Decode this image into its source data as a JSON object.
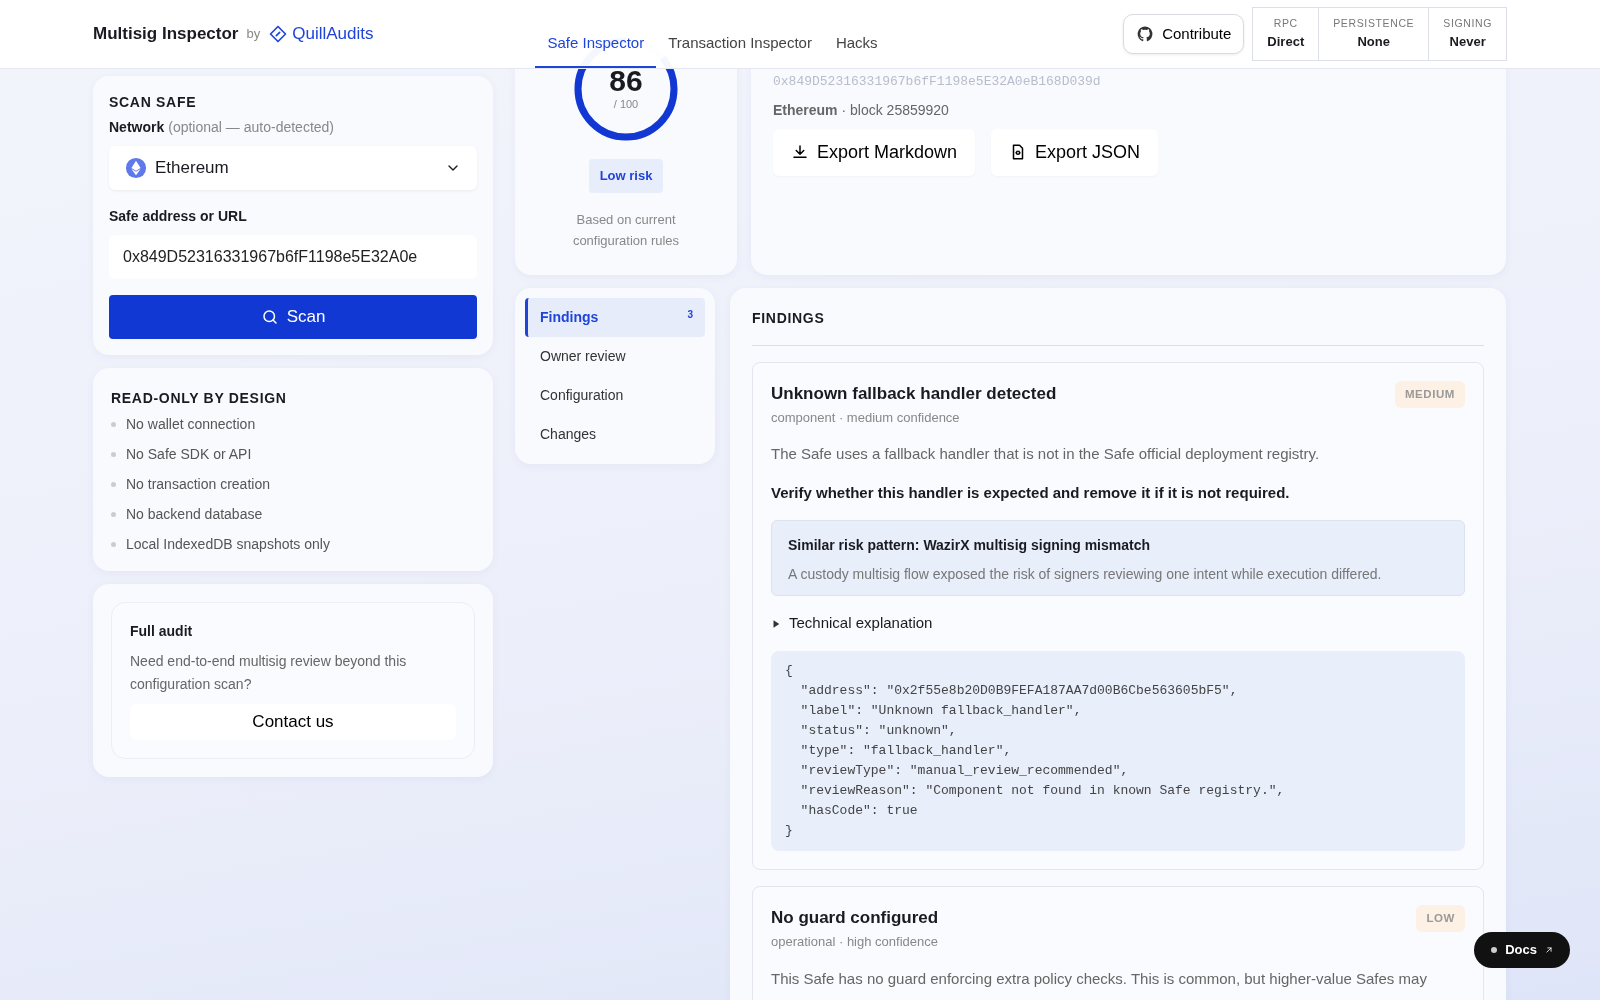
{
  "header": {
    "brand": "Multisig Inspector",
    "by": "by",
    "partner": "QuillAudits",
    "tabs": [
      {
        "label": "Safe Inspector",
        "selected": true
      },
      {
        "label": "Transaction Inspector",
        "selected": false
      },
      {
        "label": "Hacks",
        "selected": false
      }
    ],
    "contribute": "Contribute",
    "stats": [
      {
        "label": "RPC",
        "value": "Direct"
      },
      {
        "label": "PERSISTENCE",
        "value": "None"
      },
      {
        "label": "SIGNING",
        "value": "Never"
      }
    ]
  },
  "scan": {
    "title": "SCAN SAFE",
    "network_label": "Network",
    "network_hint": "(optional — auto-detected)",
    "network": "Ethereum",
    "address_label": "Safe address or URL",
    "address": "0x849D52316331967b6fF1198e5E32A0e",
    "button": "Scan"
  },
  "read_only": {
    "title": "READ-ONLY BY DESIGN",
    "items": [
      "No wallet connection",
      "No Safe SDK or API",
      "No transaction creation",
      "No backend database",
      "Local IndexedDB snapshots only"
    ]
  },
  "audit": {
    "title": "Full audit",
    "text": "Need end-to-end multisig review beyond this configuration scan?",
    "button": "Contact us"
  },
  "score": {
    "value": "86",
    "max": "/ 100",
    "level": 0.86,
    "badge": "Low risk",
    "note": "Based on current configuration rules"
  },
  "safe_info": {
    "address": "0x849D52316331967b6fF1198e5E32A0eB168D039d",
    "chain_line": "**Ethereum** · block 25859920",
    "exports": [
      {
        "kind": "download",
        "label": "Export Markdown"
      },
      {
        "kind": "file",
        "label": "Export JSON"
      }
    ]
  },
  "sections": [
    {
      "label": "Findings",
      "count": "3",
      "selected": true
    },
    {
      "label": "Owner review",
      "selected": false
    },
    {
      "label": "Configuration",
      "selected": false
    },
    {
      "label": "Changes",
      "selected": false
    }
  ],
  "findings": {
    "title": "FINDINGS",
    "items": [
      {
        "title": "Unknown fallback handler detected",
        "severity": "MEDIUM",
        "meta": "component · medium confidence",
        "description": "The Safe uses a fallback handler that is not in the Safe official deployment registry.",
        "recommendation": "Verify whether this handler is expected and remove it if it is not required.",
        "pattern": {
          "title": "Similar risk pattern: WazirX multisig signing mismatch",
          "text": "A custody multisig flow exposed the risk of signers reviewing one intent while execution differed."
        },
        "details": {
          "label": "Technical explanation",
          "code": "{\n  \"address\": \"0x2f55e8b20D0B9FEFA187AA7d00B6Cbe563605bF5\",\n  \"label\": \"Unknown fallback_handler\",\n  \"status\": \"unknown\",\n  \"type\": \"fallback_handler\",\n  \"reviewType\": \"manual_review_recommended\",\n  \"reviewReason\": \"Component not found in known Safe registry.\",\n  \"hasCode\": true\n}"
        }
      },
      {
        "title": "No guard configured",
        "severity": "LOW",
        "meta": "operational · high confidence",
        "description": "This Safe has no guard enforcing extra policy checks. This is common, but higher-value Safes may"
      }
    ]
  },
  "docs": "Docs"
}
